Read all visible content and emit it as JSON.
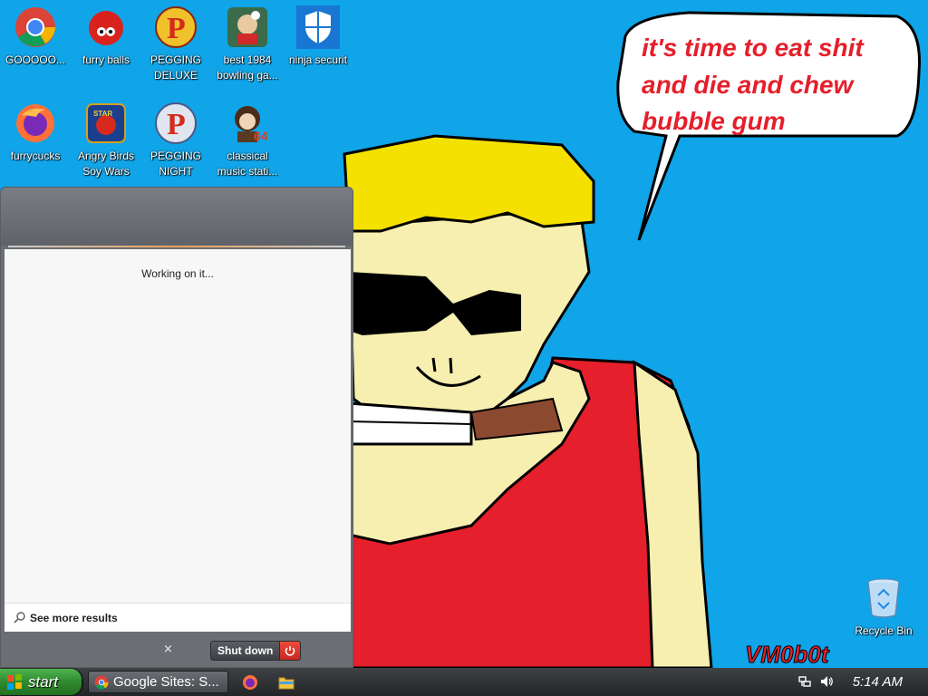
{
  "desktop": {
    "icons": [
      {
        "label": "GOOOOO...",
        "icon": "chrome-icon"
      },
      {
        "label": "furry balls",
        "icon": "furry-ball-icon"
      },
      {
        "label": "PEGGING DELUXE",
        "icon": "pegging-deluxe-icon"
      },
      {
        "label": "best 1984 bowling ga...",
        "icon": "bowling-game-icon"
      },
      {
        "label": "ninja securit",
        "icon": "shield-icon"
      },
      {
        "label": "furrycucks",
        "icon": "firefox-icon"
      },
      {
        "label": "Angry Birds Soy Wars",
        "icon": "angry-birds-icon"
      },
      {
        "label": "PEGGING NIGHT",
        "icon": "pegging-night-icon"
      },
      {
        "label": "classical music stati...",
        "icon": "portrait-icon"
      },
      {
        "label": "Recycle Bin",
        "icon": "recycle-bin-icon"
      }
    ],
    "wallpaper": {
      "speech_lines": [
        "it's time to eat shit",
        "and die and chew",
        "bubble gum"
      ],
      "signature": "VM0b0t"
    }
  },
  "start_menu": {
    "status_text": "Working on it...",
    "see_more_label": "See more results",
    "search_value": "",
    "clear_symbol": "×",
    "shutdown_label": "Shut down"
  },
  "taskbar": {
    "start_label": "start",
    "active_task_label": "Google Sites: S...",
    "clock": "5:14 AM"
  },
  "colors": {
    "desktop_bg": "#10a4e8",
    "start_green": "#2f8a2f",
    "shutdown_red": "#d9342a"
  }
}
